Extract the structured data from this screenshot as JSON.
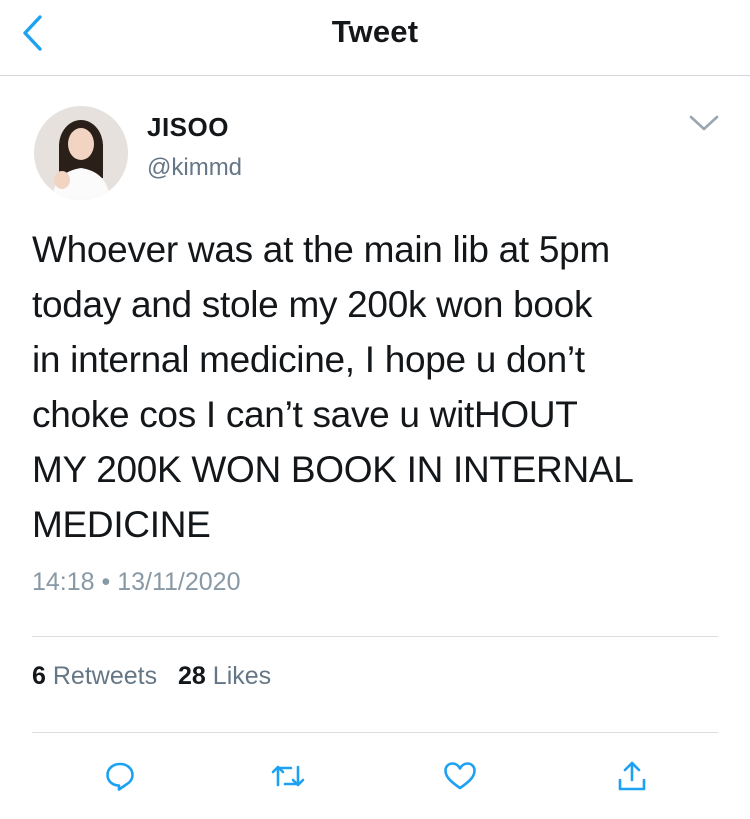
{
  "header": {
    "title": "Tweet",
    "back_icon": "chevron-left-icon",
    "accent_color": "#1da1f2"
  },
  "tweet": {
    "author_name": "JISOO",
    "author_handle": "@kimmd",
    "text_lines": [
      "Whoever was at the main lib at 5pm",
      "today and stole my 200k won book",
      "in internal medicine, I hope u don’t",
      "choke cos I can’t save u witHOUT",
      "MY 200K WON BOOK IN INTERNAL",
      "MEDICINE"
    ],
    "timestamp": "14:18 • 13/11/2020"
  },
  "stats": {
    "retweets_count": "6",
    "retweets_label": "Retweets",
    "likes_count": "28",
    "likes_label": "Likes"
  },
  "actions": {
    "icons": [
      "reply-icon",
      "retweet-icon",
      "like-icon",
      "share-icon"
    ],
    "icon_color": "#1da1f2"
  }
}
